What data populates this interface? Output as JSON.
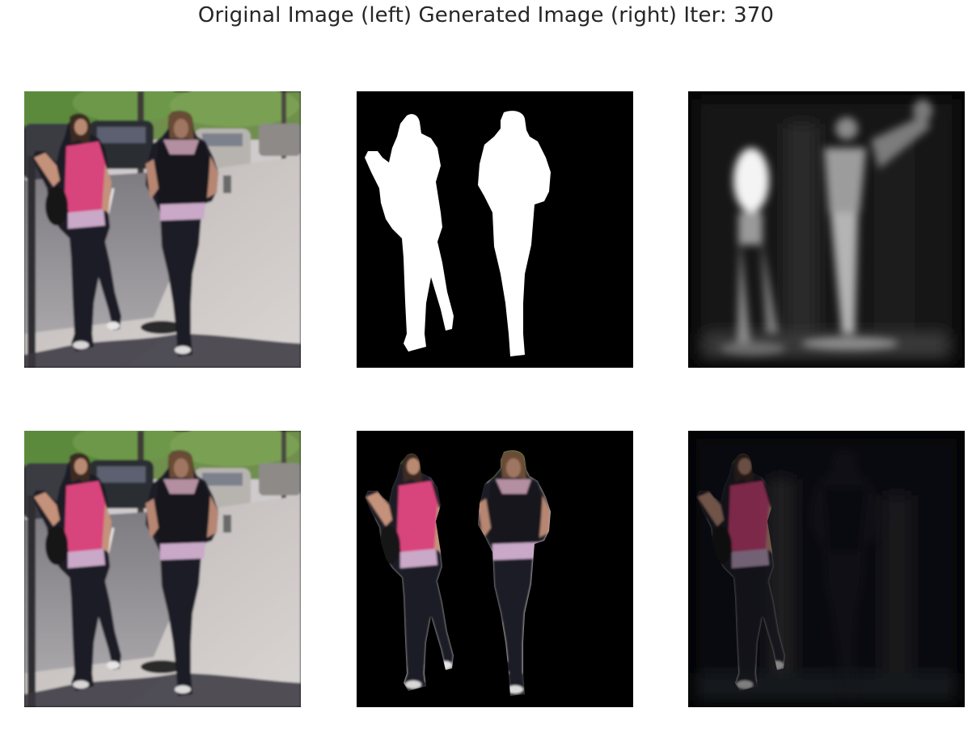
{
  "figure": {
    "title": "Original Image (left) Generated Image (right) Iter: 370"
  },
  "colors": {
    "figure_background": "#ffffff",
    "title_text": "#262626",
    "mask_foreground": "#ffffff",
    "mask_background": "#000000",
    "shirt_pink": "#d8457c",
    "tank_black": "#15161c",
    "trousers_dark": "#1b1d28",
    "waistband_lavender": "#c9a8c8",
    "sidewalk": "#c9c4c2",
    "road_asphalt": "#9d9aa0",
    "trees_green": "#5c8a3c",
    "shadow": "#3a3640"
  }
}
